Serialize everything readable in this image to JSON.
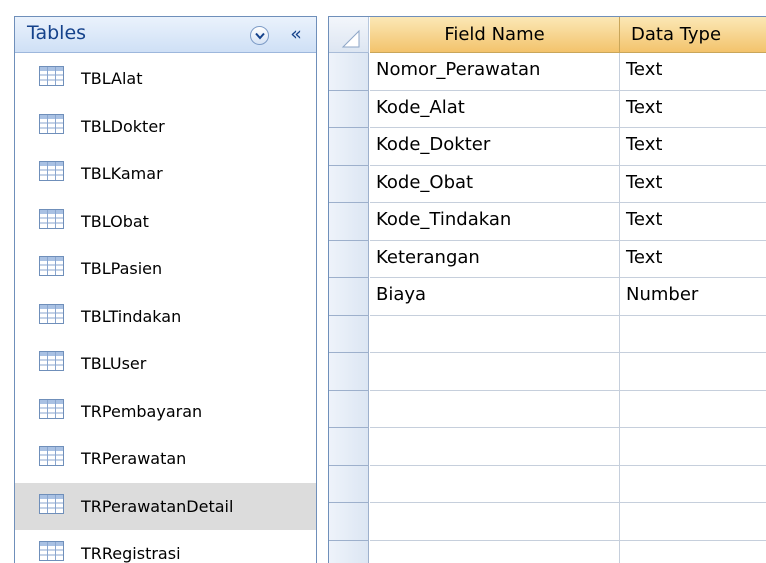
{
  "nav": {
    "title": "Tables",
    "dropdown_icon": "chevron-down-icon",
    "collapse_label": "«",
    "tables": [
      {
        "label": "TBLAlat",
        "selected": false
      },
      {
        "label": "TBLDokter",
        "selected": false
      },
      {
        "label": "TBLKamar",
        "selected": false
      },
      {
        "label": "TBLObat",
        "selected": false
      },
      {
        "label": "TBLPasien",
        "selected": false
      },
      {
        "label": "TBLTindakan",
        "selected": false
      },
      {
        "label": "TBLUser",
        "selected": false
      },
      {
        "label": "TRPembayaran",
        "selected": false
      },
      {
        "label": "TRPerawatan",
        "selected": false
      },
      {
        "label": "TRPerawatanDetail",
        "selected": true
      },
      {
        "label": "TRRegistrasi",
        "selected": false
      }
    ]
  },
  "grid": {
    "headers": {
      "field_name": "Field Name",
      "data_type": "Data Type"
    },
    "rows": [
      {
        "field": "Nomor_Perawatan",
        "type": "Text"
      },
      {
        "field": "Kode_Alat",
        "type": "Text"
      },
      {
        "field": "Kode_Dokter",
        "type": "Text"
      },
      {
        "field": "Kode_Obat",
        "type": "Text"
      },
      {
        "field": "Kode_Tindakan",
        "type": "Text"
      },
      {
        "field": "Keterangan",
        "type": "Text"
      },
      {
        "field": "Biaya",
        "type": "Number"
      },
      {
        "field": "",
        "type": ""
      },
      {
        "field": "",
        "type": ""
      },
      {
        "field": "",
        "type": ""
      },
      {
        "field": "",
        "type": ""
      },
      {
        "field": "",
        "type": ""
      },
      {
        "field": "",
        "type": ""
      },
      {
        "field": "",
        "type": ""
      }
    ]
  },
  "colors": {
    "header_text": "#15428b",
    "pane_border": "#6f8fba",
    "column_header": "#f3c36c",
    "selected_item": "#dcdcdc"
  }
}
